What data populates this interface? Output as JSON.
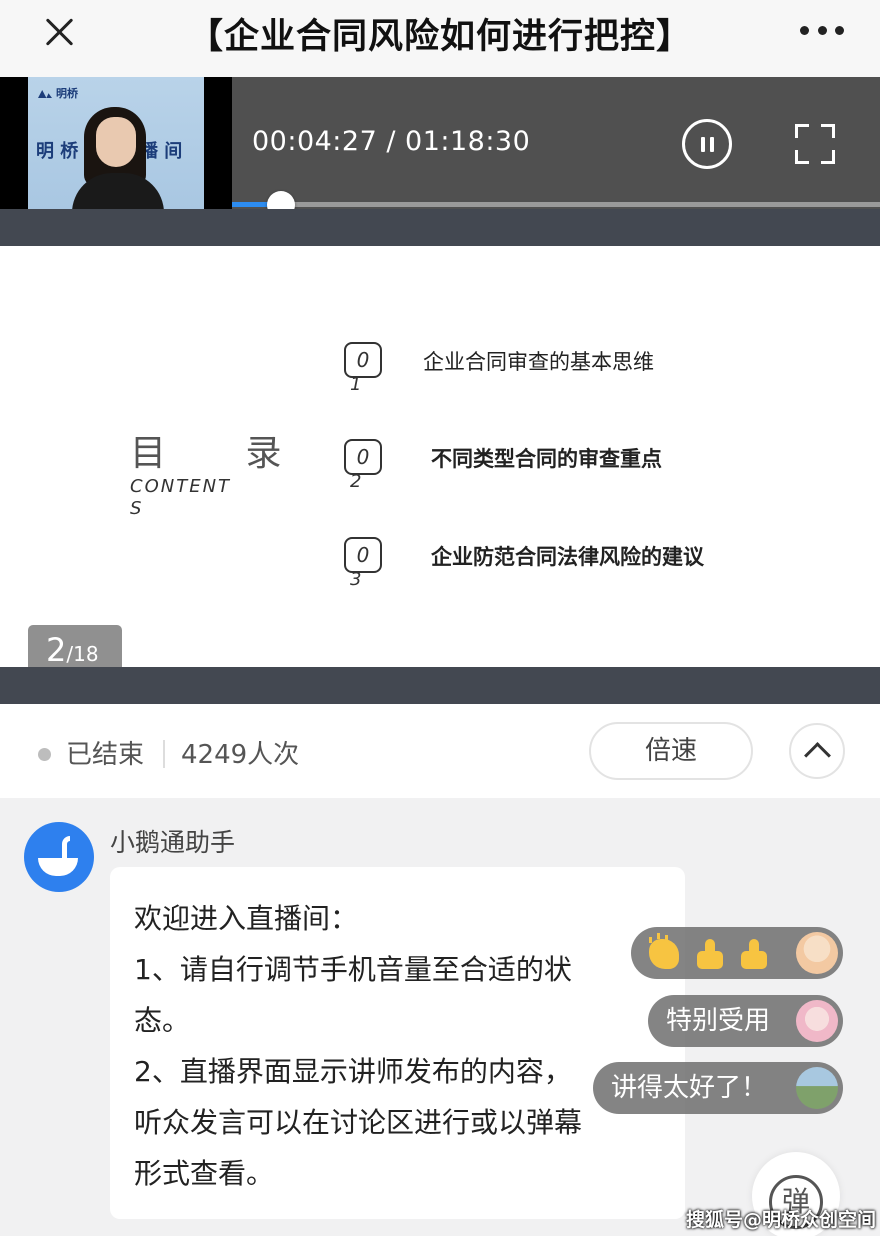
{
  "header": {
    "title": "【企业合同风险如何进行把控】"
  },
  "video": {
    "brand_logo": "明桥",
    "room_name_left": "明  桥",
    "room_name_right": "播  间",
    "time_display": "00:04:27 / 01:18:30",
    "current_time": "00:04:27",
    "total_time": "01:18:30",
    "progress": 0.076,
    "accent_color": "#2d8cf0"
  },
  "slide": {
    "toc_title": "目 录",
    "toc_sub": "CONTENTS",
    "items": [
      {
        "num_top": "0",
        "num_bottom": "1",
        "text": "企业合同审查的基本思维"
      },
      {
        "num_top": "0",
        "num_bottom": "2",
        "text": "不同类型合同的审查重点"
      },
      {
        "num_top": "0",
        "num_bottom": "3",
        "text": "企业防范合同法律风险的建议"
      }
    ],
    "page_current": "2",
    "page_total": "/18"
  },
  "status": {
    "state": "已结束",
    "viewers": "4249人次",
    "speed_label": "倍速"
  },
  "chat": {
    "sender": "小鹅通助手",
    "message_lines": [
      "欢迎进入直播间：",
      "1、请自行调节手机音量至合适的状",
      "态。",
      "2、直播界面显示讲师发布的内容，",
      "听众发言可以在讨论区进行或以弹幕",
      "形式查看。"
    ]
  },
  "danmaku": [
    {
      "text": "",
      "icons": [
        "clap-icon",
        "thumbs-up-icon",
        "thumbs-up-icon"
      ],
      "avatar_color": "#f3c9a2"
    },
    {
      "text": "特别受用",
      "avatar_color": "#f0b8c8"
    },
    {
      "text": "讲得太好了！",
      "avatar_color": "#7fa16b"
    }
  ],
  "danmu_toggle_label": "弹",
  "watermark": "搜狐号@明桥众创空间"
}
